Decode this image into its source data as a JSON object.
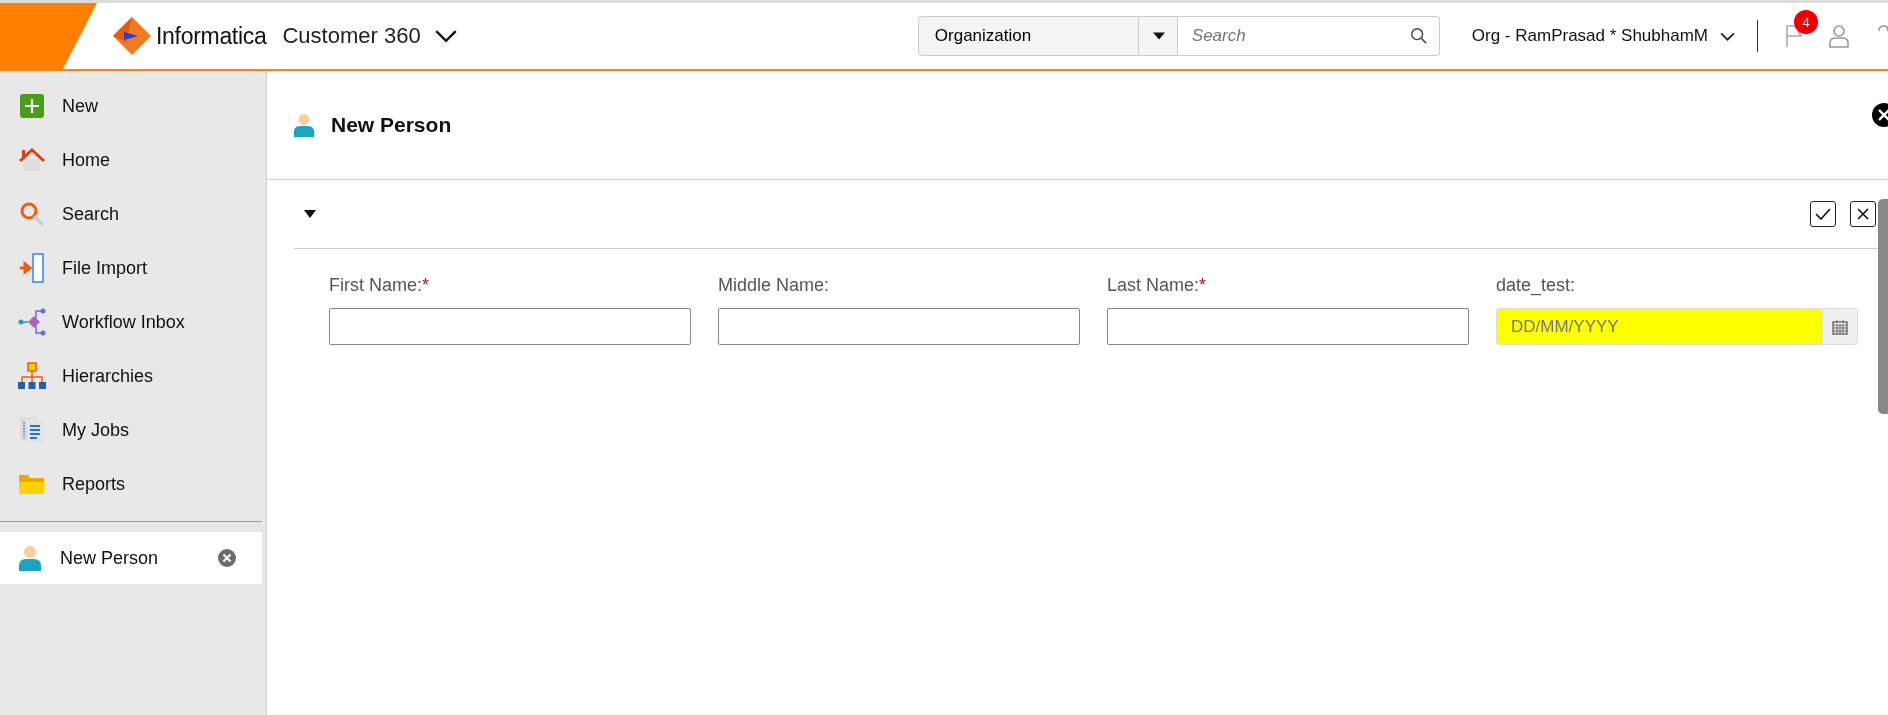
{
  "header": {
    "brand": "Informatica",
    "app": "Customer 360",
    "search_scope": "Organization",
    "search": {
      "placeholder": "Search"
    },
    "org": "Org - RamPrasad * ShubhamM",
    "notification_count": "4"
  },
  "sidebar": {
    "items": [
      {
        "label": "New",
        "kind": "new",
        "selected": false
      },
      {
        "label": "Home",
        "kind": "home",
        "selected": false
      },
      {
        "label": "Search",
        "kind": "search",
        "selected": false
      },
      {
        "label": "File Import",
        "kind": "import",
        "selected": false
      },
      {
        "label": "Workflow Inbox",
        "kind": "workflow",
        "selected": false
      },
      {
        "label": "Hierarchies",
        "kind": "hierarchy",
        "selected": false
      },
      {
        "label": "My Jobs",
        "kind": "jobs",
        "selected": false
      },
      {
        "label": "Reports",
        "kind": "reports",
        "selected": false
      }
    ],
    "open_records": [
      {
        "label": "New Person",
        "selected": true
      }
    ]
  },
  "panel": {
    "title": "New Person",
    "section": {
      "expanded": true,
      "fields": [
        {
          "kind": "text",
          "label": "First Name:",
          "required_mark": "*"
        },
        {
          "kind": "text",
          "label": "Middle Name:"
        },
        {
          "kind": "text",
          "label": "Last Name:",
          "required_mark": "*"
        },
        {
          "kind": "date",
          "label": "date_test:",
          "placeholder": "DD/MM/YYYY",
          "highlighted": true
        }
      ]
    }
  }
}
